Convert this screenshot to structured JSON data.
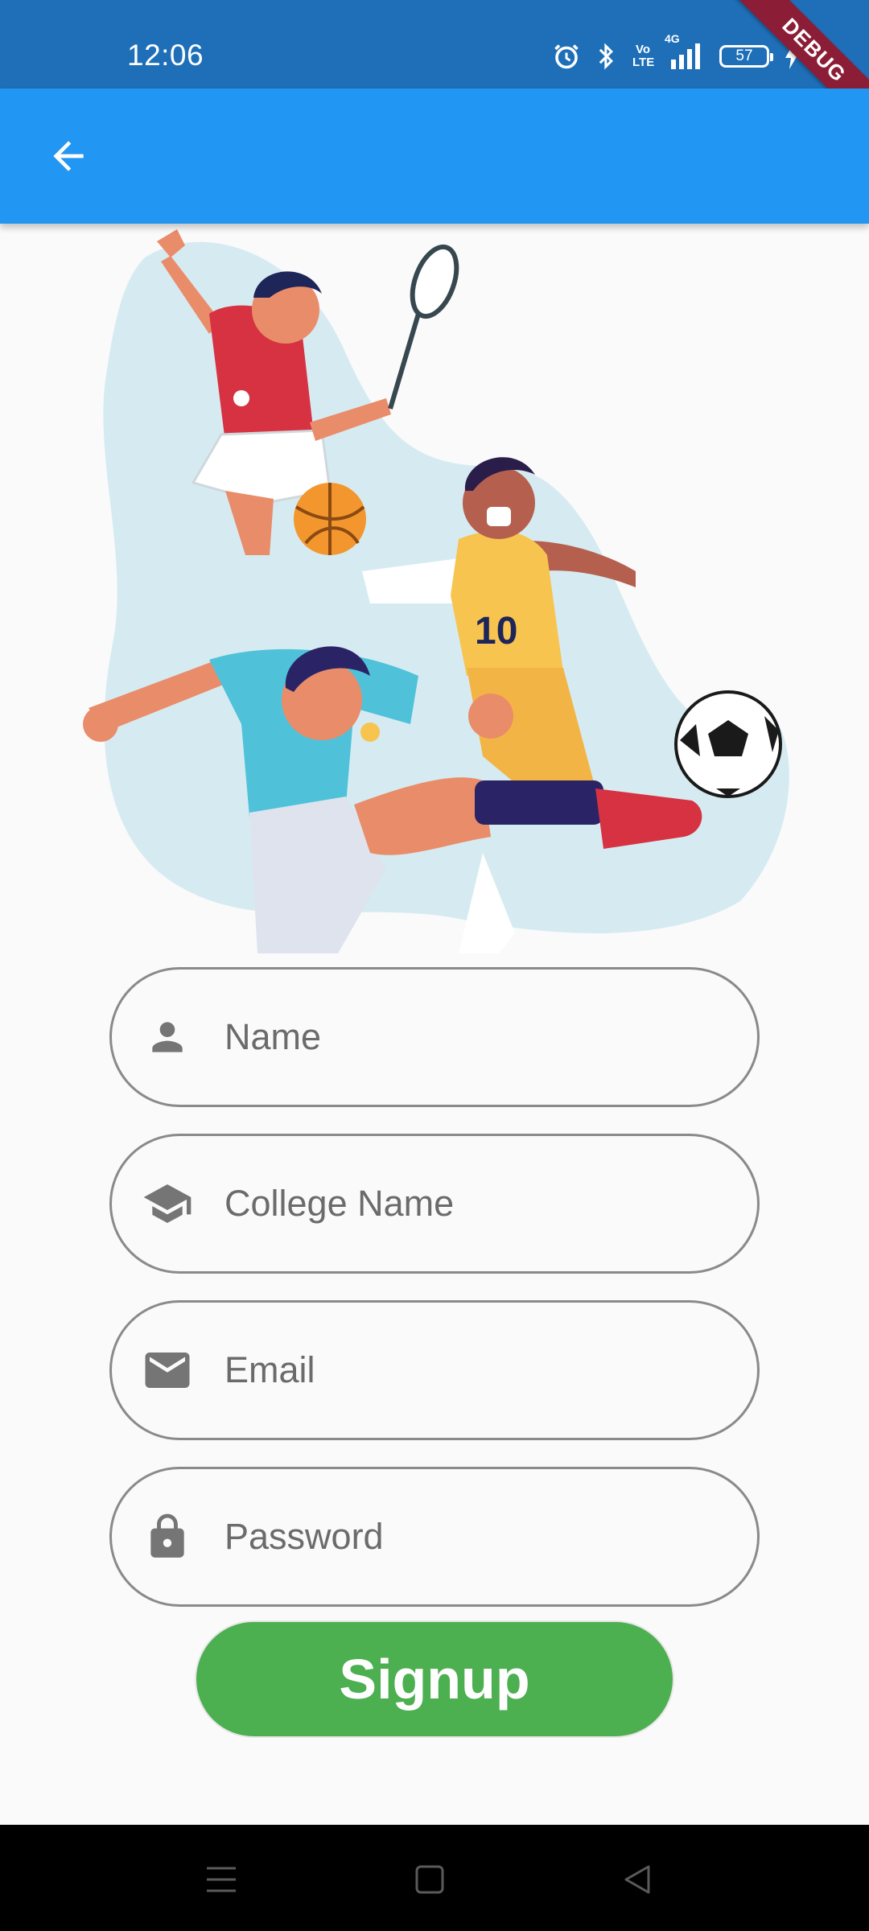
{
  "status_bar": {
    "time": "12:06",
    "network_label": "4G",
    "volte_label": "Vo LTE",
    "battery_level": "57",
    "debug_label": "DEBUG",
    "icons": [
      "alarm-icon",
      "bluetooth-icon",
      "volte-icon",
      "signal-icon",
      "battery-icon",
      "charging-icon"
    ]
  },
  "app_bar": {
    "back_icon": "arrow-left-icon"
  },
  "hero": {
    "illustration": "sports-players-illustration",
    "jersey_number": "10"
  },
  "form": {
    "name": {
      "placeholder": "Name",
      "icon": "person-icon"
    },
    "college": {
      "placeholder": "College Name",
      "icon": "school-icon"
    },
    "email": {
      "placeholder": "Email",
      "icon": "mail-icon"
    },
    "password": {
      "placeholder": "Password",
      "icon": "lock-icon"
    },
    "submit_label": "Signup"
  },
  "colors": {
    "status_bar": "#1e6fb8",
    "app_bar": "#2196f3",
    "signup_button": "#4caf50",
    "field_border": "#8a8a8a",
    "background": "#fafafa"
  },
  "nav_bar": {
    "items": [
      "menu-icon",
      "home-icon",
      "back-triangle-icon"
    ]
  }
}
